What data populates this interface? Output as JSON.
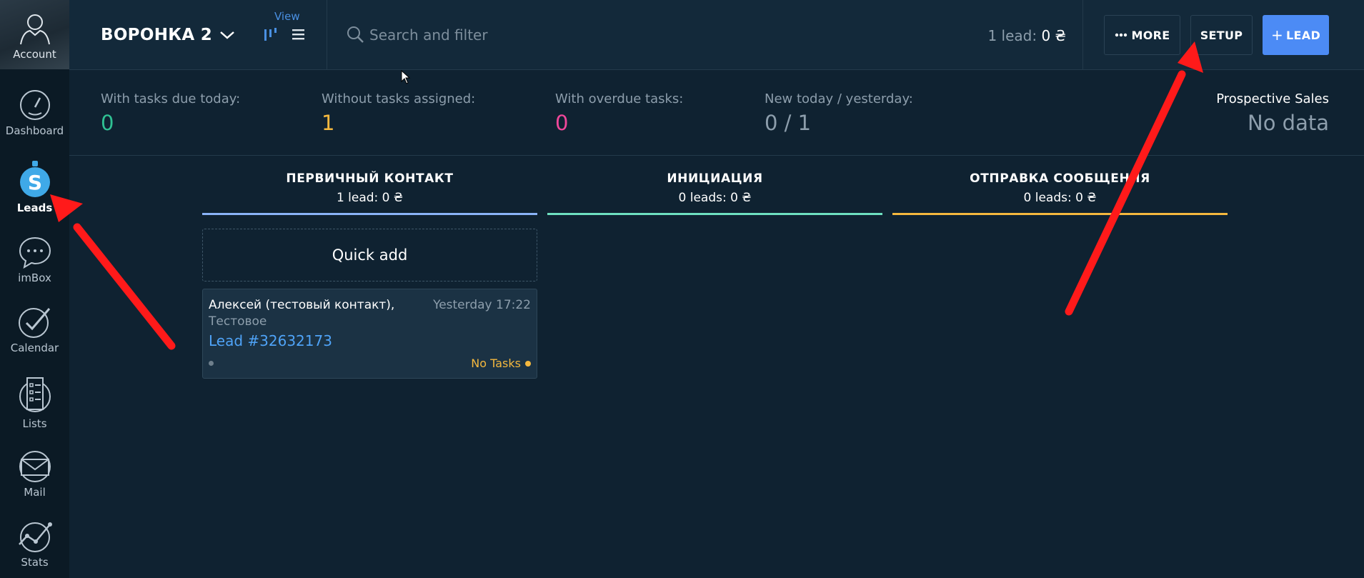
{
  "sidebar": {
    "account_label": "Account",
    "items": [
      {
        "label": "Dashboard",
        "icon": "dashboard-icon"
      },
      {
        "label": "Leads",
        "icon": "leads-icon",
        "active": true
      },
      {
        "label": "imBox",
        "icon": "chat-icon"
      },
      {
        "label": "Calendar",
        "icon": "calendar-check-icon"
      },
      {
        "label": "Lists",
        "icon": "list-icon"
      },
      {
        "label": "Mail",
        "icon": "mail-icon"
      },
      {
        "label": "Stats",
        "icon": "stats-icon"
      }
    ]
  },
  "header": {
    "pipeline_name": "ВОРОНКА 2",
    "view_label": "View",
    "search_placeholder": "Search and filter",
    "lead_total_prefix": "1 lead:",
    "lead_total_value": "0 ₴",
    "more_label": "MORE",
    "setup_label": "SETUP",
    "lead_button_label": "LEAD"
  },
  "stats": {
    "today": {
      "title": "With tasks due today:",
      "value": "0"
    },
    "no_tasks": {
      "title": "Without tasks assigned:",
      "value": "1"
    },
    "overdue": {
      "title": "With overdue tasks:",
      "value": "0"
    },
    "new": {
      "title": "New today / yesterday:",
      "value": "0 / 1"
    },
    "sales": {
      "title": "Prospective Sales",
      "value": "No data"
    }
  },
  "columns": [
    {
      "title": "ПЕРВИЧНЫЙ КОНТАКТ",
      "meta": "1 lead: 0 ₴"
    },
    {
      "title": "ИНИЦИАЦИЯ",
      "meta": "0 leads: 0 ₴"
    },
    {
      "title": "ОТПРАВКА СООБЩЕНИЯ",
      "meta": "0 leads: 0 ₴"
    }
  ],
  "quick_add_label": "Quick add",
  "card": {
    "contact": "Алексей (тестовый контакт),",
    "time": "Yesterday 17:22",
    "company": "Тестовое",
    "lead_name": "Lead #32632173",
    "tasks": "No Tasks"
  },
  "colors": {
    "accent": "#4c8bf5",
    "stage_1": "#8ab4f8",
    "stage_2": "#6ee0c0",
    "stage_3": "#f4b83e",
    "annotation_arrow": "#ff1a1a"
  }
}
